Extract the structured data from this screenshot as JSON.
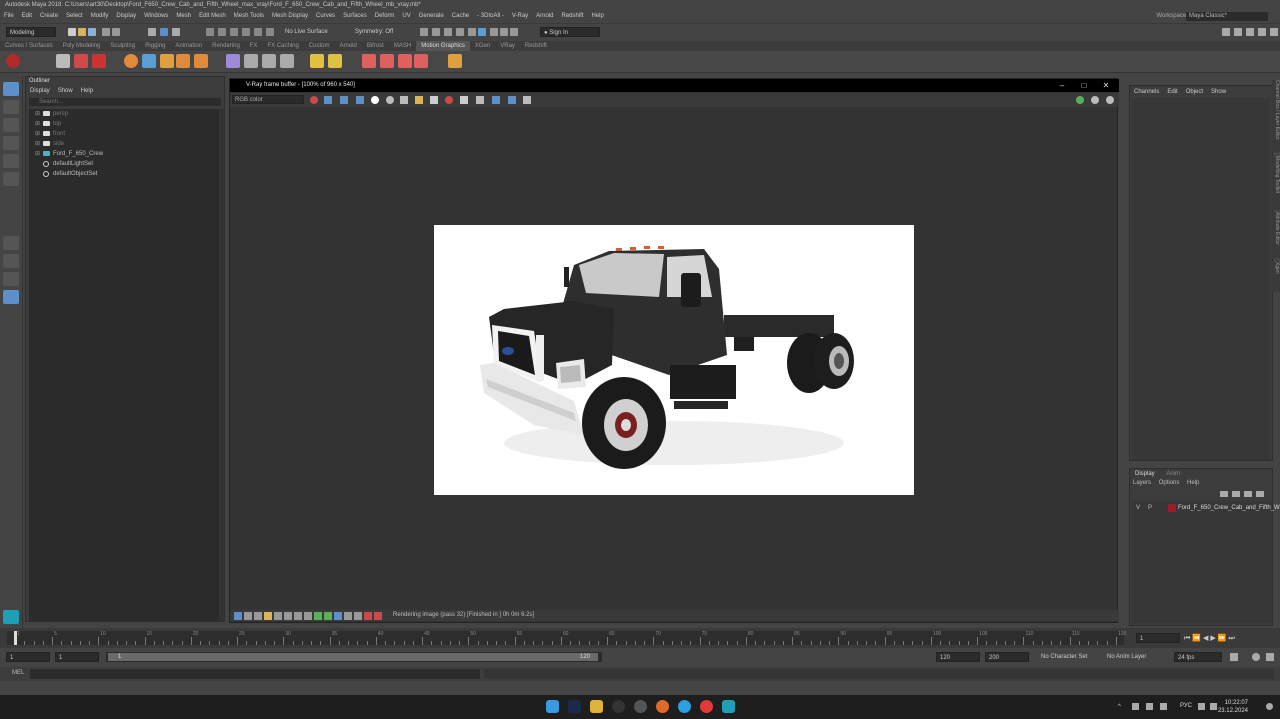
{
  "app_title": "Autodesk Maya 2018: C:\\Users\\art30\\Desktop\\Ford_F650_Crew_Cab_and_Fifth_Wheel_max_vray\\Ford_F_650_Crew_Cab_and_Fifth_Wheel_mb_vray.mb*",
  "menu": [
    "File",
    "Edit",
    "Create",
    "Select",
    "Modify",
    "Display",
    "Windows",
    "Mesh",
    "Edit Mesh",
    "Mesh Tools",
    "Mesh Display",
    "Curves",
    "Surfaces",
    "Deform",
    "UV",
    "Generate",
    "Cache",
    "- 3DtoAll -",
    "V-Ray",
    "Arnold",
    "Redshift",
    "Help"
  ],
  "workspace": {
    "label": "Workspace:",
    "value": "Maya Classic*"
  },
  "statusline": {
    "mode": "Modeling",
    "live_surface": "No Live Surface",
    "symmetry": "Symmetry: Off",
    "sign_in": "Sign In"
  },
  "shelf_tabs": [
    "Curves / Surfaces",
    "Poly Modeling",
    "Sculpting",
    "Rigging",
    "Animation",
    "Rendering",
    "FX",
    "FX Caching",
    "Custom",
    "Arnold",
    "Bifrost",
    "MASH",
    "Motion Graphics",
    "XGen",
    "VRay",
    "Redshift"
  ],
  "shelf_active": "Motion Graphics",
  "outliner": {
    "title": "Outliner",
    "menu": [
      "Display",
      "Show",
      "Help"
    ],
    "search_placeholder": "Search...",
    "items": [
      {
        "label": "persp",
        "dim": true,
        "type": "camera"
      },
      {
        "label": "top",
        "dim": true,
        "type": "camera"
      },
      {
        "label": "front",
        "dim": true,
        "type": "camera"
      },
      {
        "label": "side",
        "dim": true,
        "type": "camera"
      },
      {
        "label": "Ford_F_650_Crew",
        "dim": false,
        "type": "group"
      },
      {
        "label": "defaultLightSet",
        "dim": false,
        "type": "set"
      },
      {
        "label": "defaultObjectSet",
        "dim": false,
        "type": "set"
      }
    ]
  },
  "vray": {
    "title": "V-Ray frame buffer - [100% of 960 x 540]",
    "channel": "RGB color",
    "status": "Rendering image (pass 32) [Finished in ] 0h  0m  6.2s]"
  },
  "channel_box": {
    "menu": [
      "Channels",
      "Edit",
      "Object",
      "Show"
    ]
  },
  "layers": {
    "tabs": [
      "Display",
      "Anim"
    ],
    "menu": [
      "Layers",
      "Options",
      "Help"
    ],
    "row": {
      "v": "V",
      "p": "P",
      "name": "Ford_F_650_Crew_Cab_and_Fifth_W",
      "color": "#9b1c2b"
    }
  },
  "side_tabs": [
    "Channel Box / Layer Editor",
    "Modelling Toolkit",
    "Attribute Editor",
    "Xgen"
  ],
  "timeline": {
    "ticks": [
      "1",
      "5",
      "10",
      "15",
      "20",
      "25",
      "30",
      "35",
      "40",
      "45",
      "50",
      "55",
      "60",
      "65",
      "70",
      "75",
      "80",
      "85",
      "90",
      "95",
      "100",
      "105",
      "110",
      "115",
      "120"
    ],
    "current_frame": "1"
  },
  "range": {
    "start": "1",
    "start2": "1",
    "slider_left": "1",
    "slider_right": "120",
    "end": "120",
    "end2": "200",
    "char_set": "No Character Set",
    "anim_layer": "No Anim Layer",
    "fps": "24 fps"
  },
  "cmd": {
    "label": "MEL"
  },
  "taskbar": {
    "lang": "РУС",
    "time": "10:22:07",
    "date": "23.12.2024"
  }
}
